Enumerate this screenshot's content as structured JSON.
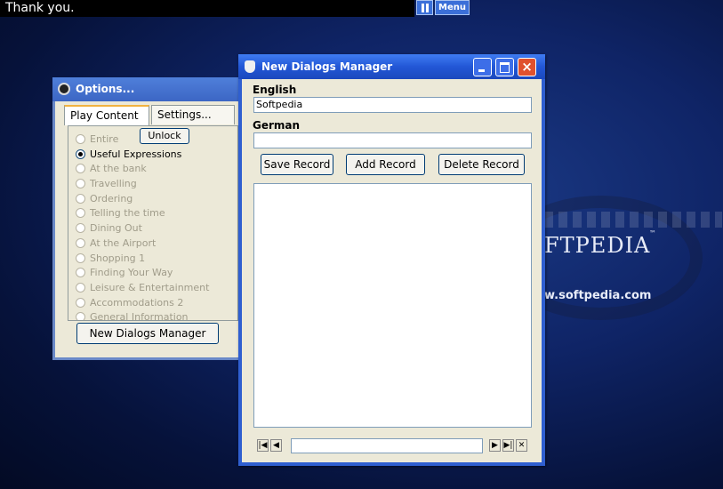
{
  "topbar": {
    "message": "Thank you.",
    "menu_label": "Menu"
  },
  "background": {
    "logo_text": "FTPEDIA",
    "trademark": "™",
    "url": "w.softpedia.com"
  },
  "options_window": {
    "title": "Options...",
    "tabs": [
      {
        "label": "Play Content",
        "active": true
      },
      {
        "label": "Settings...",
        "active": false
      }
    ],
    "unlock_label": "Unlock",
    "radio_items": [
      {
        "label": "Entire",
        "checked": false
      },
      {
        "label": "Useful Expressions",
        "checked": true
      },
      {
        "label": "At the bank",
        "checked": false
      },
      {
        "label": "Travelling",
        "checked": false
      },
      {
        "label": "Ordering",
        "checked": false
      },
      {
        "label": "Telling the time",
        "checked": false
      },
      {
        "label": "Dining Out",
        "checked": false
      },
      {
        "label": "At the Airport",
        "checked": false
      },
      {
        "label": "Shopping 1",
        "checked": false
      },
      {
        "label": "Finding Your Way",
        "checked": false
      },
      {
        "label": "Leisure & Entertainment",
        "checked": false
      },
      {
        "label": "Accommodations 2",
        "checked": false
      },
      {
        "label": "General Information",
        "checked": false
      }
    ],
    "new_dialogs_button": "New Dialogs Manager"
  },
  "ndm_window": {
    "title": "New Dialogs Manager",
    "english_label": "English",
    "english_value": "Softpedia",
    "german_label": "German",
    "german_value": "",
    "save_label": "Save Record",
    "add_label": "Add Record",
    "delete_label": "Delete Record",
    "nav_value": ""
  }
}
